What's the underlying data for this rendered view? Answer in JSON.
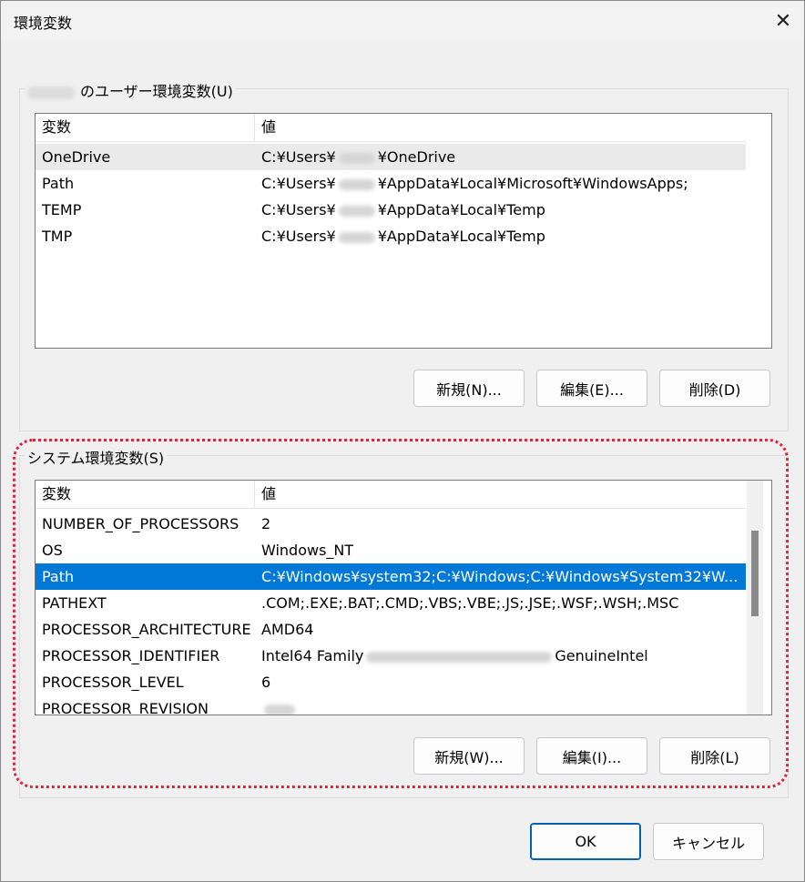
{
  "window": {
    "title": "環境変数"
  },
  "user_group": {
    "label": "のユーザー環境変数(U)",
    "columns": [
      "変数",
      "値"
    ],
    "rows": [
      {
        "name": "OneDrive",
        "value_pre": "C:¥Users¥",
        "value_post": "¥OneDrive"
      },
      {
        "name": "Path",
        "value_pre": "C:¥Users¥",
        "value_post": "¥AppData¥Local¥Microsoft¥WindowsApps;"
      },
      {
        "name": "TEMP",
        "value_pre": "C:¥Users¥",
        "value_post": "¥AppData¥Local¥Temp"
      },
      {
        "name": "TMP",
        "value_pre": "C:¥Users¥",
        "value_post": "¥AppData¥Local¥Temp"
      }
    ],
    "buttons": {
      "new": "新規(N)...",
      "edit": "編集(E)...",
      "delete": "削除(D)"
    }
  },
  "system_group": {
    "label": "システム環境変数(S)",
    "columns": [
      "変数",
      "値"
    ],
    "rows": [
      {
        "name": "NUMBER_OF_PROCESSORS",
        "value": "2"
      },
      {
        "name": "OS",
        "value": "Windows_NT"
      },
      {
        "name": "Path",
        "value": "C:¥Windows¥system32;C:¥Windows;C:¥Windows¥System32¥W..."
      },
      {
        "name": "PATHEXT",
        "value": ".COM;.EXE;.BAT;.CMD;.VBS;.VBE;.JS;.JSE;.WSF;.WSH;.MSC"
      },
      {
        "name": "PROCESSOR_ARCHITECTURE",
        "value": "AMD64"
      },
      {
        "name": "PROCESSOR_IDENTIFIER",
        "value_pre": "Intel64 Family",
        "value_post": "GenuineIntel"
      },
      {
        "name": "PROCESSOR_LEVEL",
        "value": "6"
      },
      {
        "name": "PROCESSOR_REVISION",
        "value": ""
      }
    ],
    "buttons": {
      "new": "新規(W)...",
      "edit": "編集(I)...",
      "delete": "削除(L)"
    }
  },
  "footer": {
    "ok": "OK",
    "cancel": "キャンセル"
  },
  "colors": {
    "selection": "#0078d7",
    "highlight_outline": "#e0263a"
  }
}
